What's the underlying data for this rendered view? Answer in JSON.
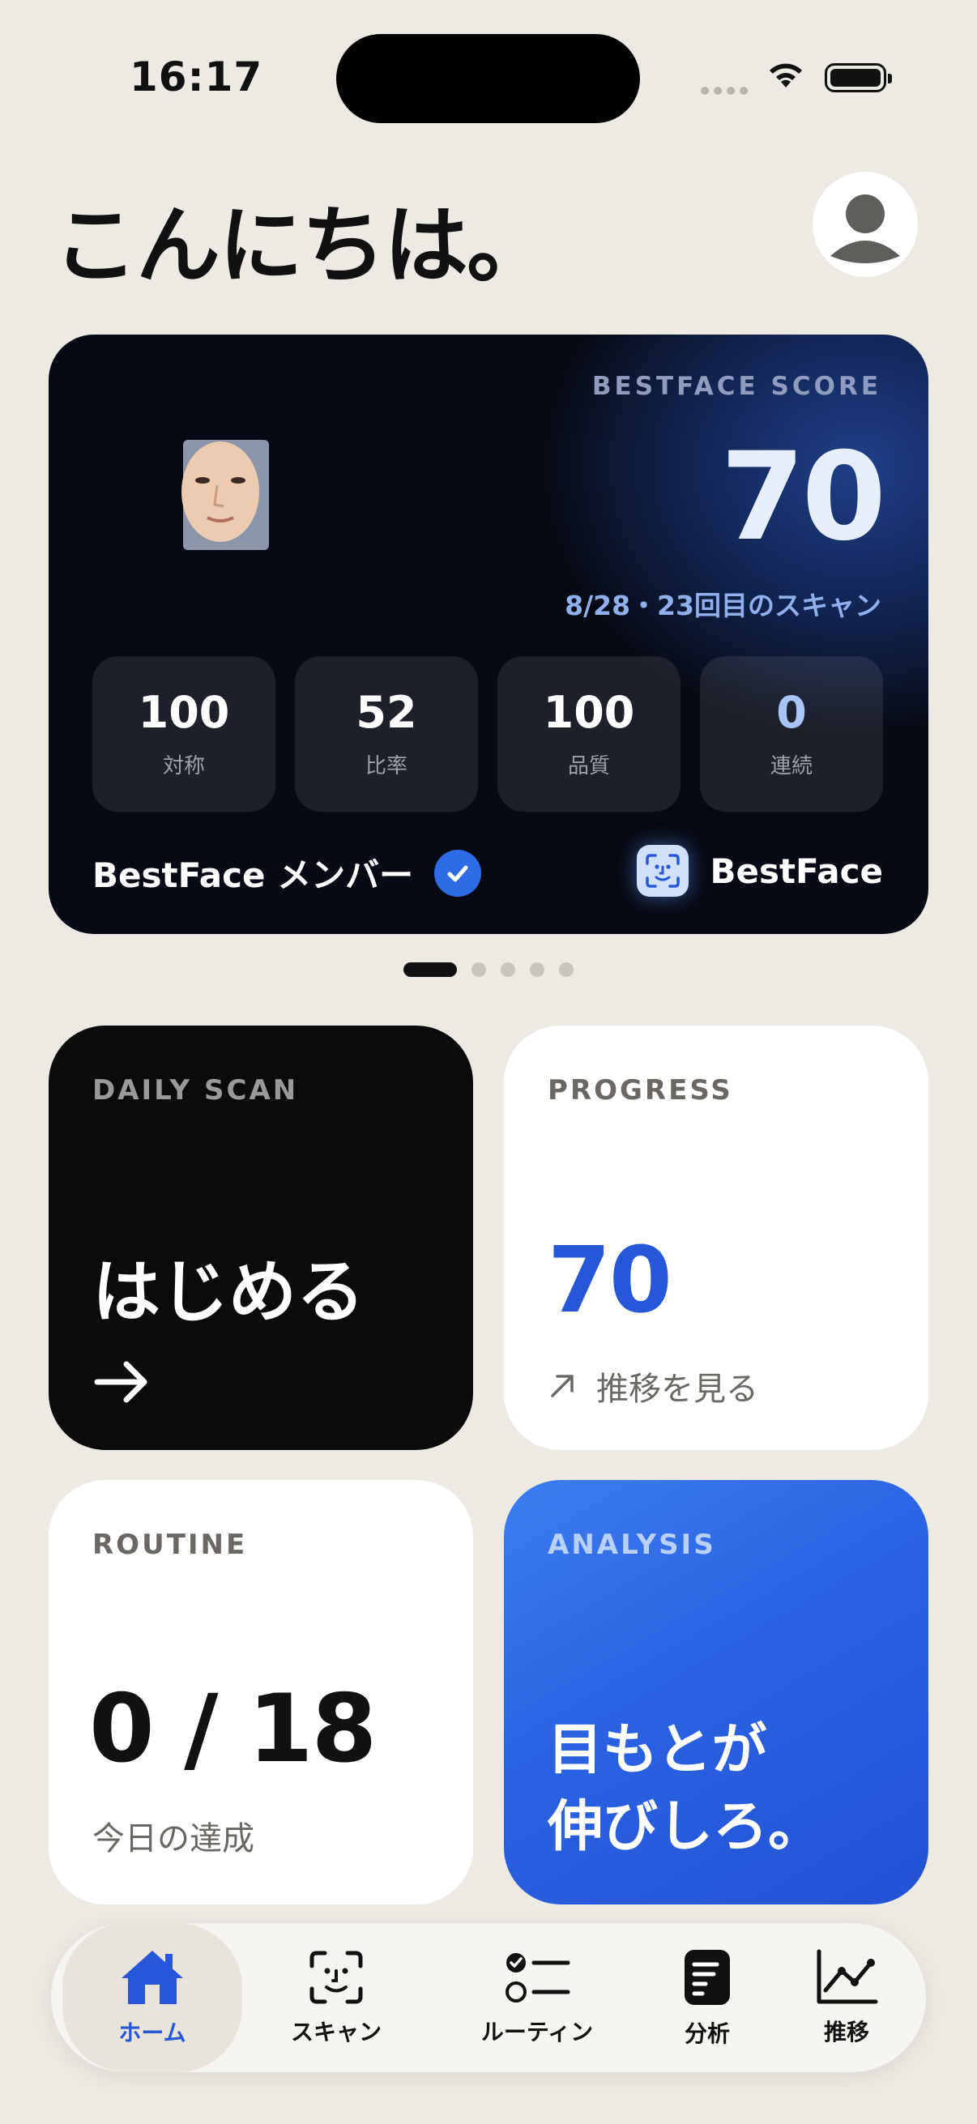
{
  "status_bar": {
    "time": "16:17"
  },
  "header": {
    "greeting": "こんにちは。"
  },
  "score_card": {
    "label": "BESTFACE SCORE",
    "score": "70",
    "scan_info": "8/28・23回目のスキャン",
    "stats": [
      {
        "value": "100",
        "label": "対称"
      },
      {
        "value": "52",
        "label": "比率"
      },
      {
        "value": "100",
        "label": "品質"
      },
      {
        "value": "0",
        "label": "連続"
      }
    ],
    "member_label": "BestFace メンバー",
    "brand": "BestFace"
  },
  "pager": {
    "count": 5,
    "active": 0
  },
  "tiles": {
    "daily": {
      "label": "DAILY SCAN",
      "title": "はじめる"
    },
    "progress": {
      "label": "PROGRESS",
      "value": "70",
      "link": "推移を見る"
    },
    "routine": {
      "label": "ROUTINE",
      "value": "0 / 18",
      "sub": "今日の達成"
    },
    "analysis": {
      "label": "ANALYSIS",
      "line1": "目もとが",
      "line2": "伸びしろ。"
    }
  },
  "tabbar": {
    "items": [
      {
        "label": "ホーム",
        "icon": "home-icon"
      },
      {
        "label": "スキャン",
        "icon": "face-scan-icon"
      },
      {
        "label": "ルーティン",
        "icon": "checklist-icon"
      },
      {
        "label": "分析",
        "icon": "document-icon"
      },
      {
        "label": "推移",
        "icon": "chart-icon"
      }
    ]
  },
  "colors": {
    "accent": "#2757d9",
    "background": "#EDEAE3",
    "card_dark": "#0b0b0b"
  }
}
